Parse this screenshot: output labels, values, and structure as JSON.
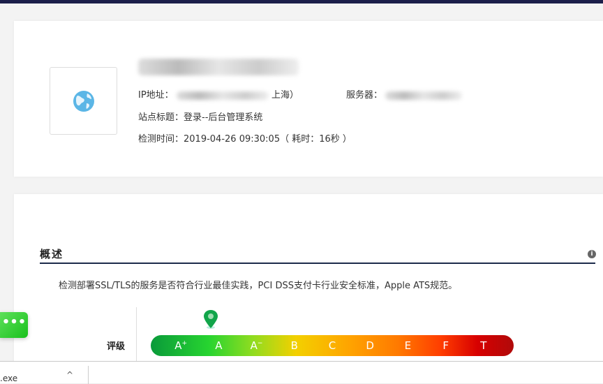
{
  "site": {
    "ip_label": "IP地址：",
    "ip_suffix": "上海）",
    "server_label": "服务器：",
    "title_label": "站点标题：",
    "title_value": "登录--后台管理系统",
    "time_label": "检测时间：",
    "time_value": "2019-04-26 09:30:05（ 耗时：16秒 ）"
  },
  "overview": {
    "heading": "概述",
    "info_icon": "i",
    "description": "检测部署SSL/TLS的服务是否符合行业最佳实践，PCI DSS支付卡行业安全标准，Apple ATS规范。",
    "rating_label": "评级",
    "grades": [
      "A",
      "A",
      "A",
      "B",
      "C",
      "D",
      "E",
      "F",
      "T"
    ],
    "grade_marks": [
      "+",
      "",
      "−",
      "",
      "",
      "",
      "",
      "",
      ""
    ],
    "current_grade": "A"
  },
  "fab": {
    "label": "•••"
  },
  "download": {
    "file": ".exe",
    "chevron": "^"
  }
}
